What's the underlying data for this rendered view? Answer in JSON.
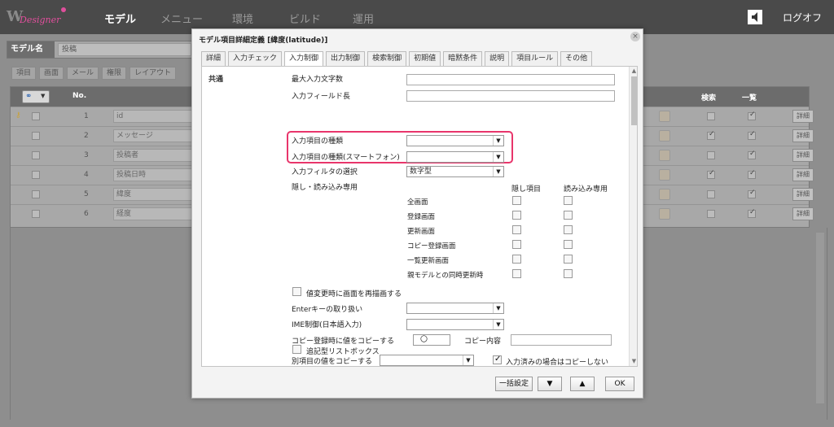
{
  "nav": {
    "logo_text": "Web Designer",
    "items": [
      "モデル",
      "メニュー",
      "環境",
      "ビルド",
      "運用"
    ],
    "logout": "ログオフ"
  },
  "model": {
    "label": "モデル名",
    "value": "投稿"
  },
  "bg_tabs": [
    "項目",
    "画面",
    "メール",
    "権限",
    "レイアウト"
  ],
  "grid": {
    "headers": {
      "no": "No.",
      "search": "検索",
      "list": "一覧"
    },
    "rows": [
      {
        "no": "1",
        "name": "id",
        "search": false,
        "list": true,
        "detail": "詳細"
      },
      {
        "no": "2",
        "name": "メッセージ",
        "search": true,
        "list": true,
        "detail": "詳細"
      },
      {
        "no": "3",
        "name": "投稿者",
        "search": false,
        "list": true,
        "detail": "詳細"
      },
      {
        "no": "4",
        "name": "投稿日時",
        "search": true,
        "list": true,
        "detail": "詳細"
      },
      {
        "no": "5",
        "name": "緯度",
        "search": false,
        "list": true,
        "detail": "詳細"
      },
      {
        "no": "6",
        "name": "経度",
        "search": false,
        "list": true,
        "detail": "詳細"
      }
    ]
  },
  "dialog": {
    "title": "モデル項目詳細定義 [緯度(latitude)]",
    "close": "×",
    "tabs": [
      "詳細",
      "入力チェック",
      "入力制御",
      "出力制御",
      "検索制御",
      "初期値",
      "暗黙条件",
      "説明",
      "項目ルール",
      "その他"
    ],
    "active_tab": "入力制御",
    "section": "共通",
    "labels": {
      "max_len": "最大入力文字数",
      "field_len": "入力フィールド長",
      "input_type": "入力項目の種類",
      "input_type_sp": "入力項目の種類(スマートフォン)",
      "input_filter": "入力フィルタの選択",
      "hidden_readonly": "隠し・読み込み専用",
      "col_hidden": "隠し項目",
      "col_readonly": "読み込み専用",
      "redraw": "値変更時に画面を再描画する",
      "enter_key": "Enterキーの取り扱い",
      "ime": "IME制御(日本語入力)",
      "copy_on_register": "コピー登録時に値をコピーする",
      "copy_content": "コピー内容",
      "copy_from_other": "別項目の値をコピーする",
      "no_copy_if_filled": "入力済みの場合はコピーしない",
      "appendable_listbox": "追記型リストボックス"
    },
    "filter_value": "数字型",
    "copy_value": "〇",
    "screens": [
      "全画面",
      "登録画面",
      "更新画面",
      "コピー登録画面",
      "一覧更新画面",
      "親モデルとの同時更新時"
    ],
    "buttons": {
      "bulk": "一括設定",
      "down": "▼",
      "up": "▲",
      "ok": "OK"
    }
  }
}
